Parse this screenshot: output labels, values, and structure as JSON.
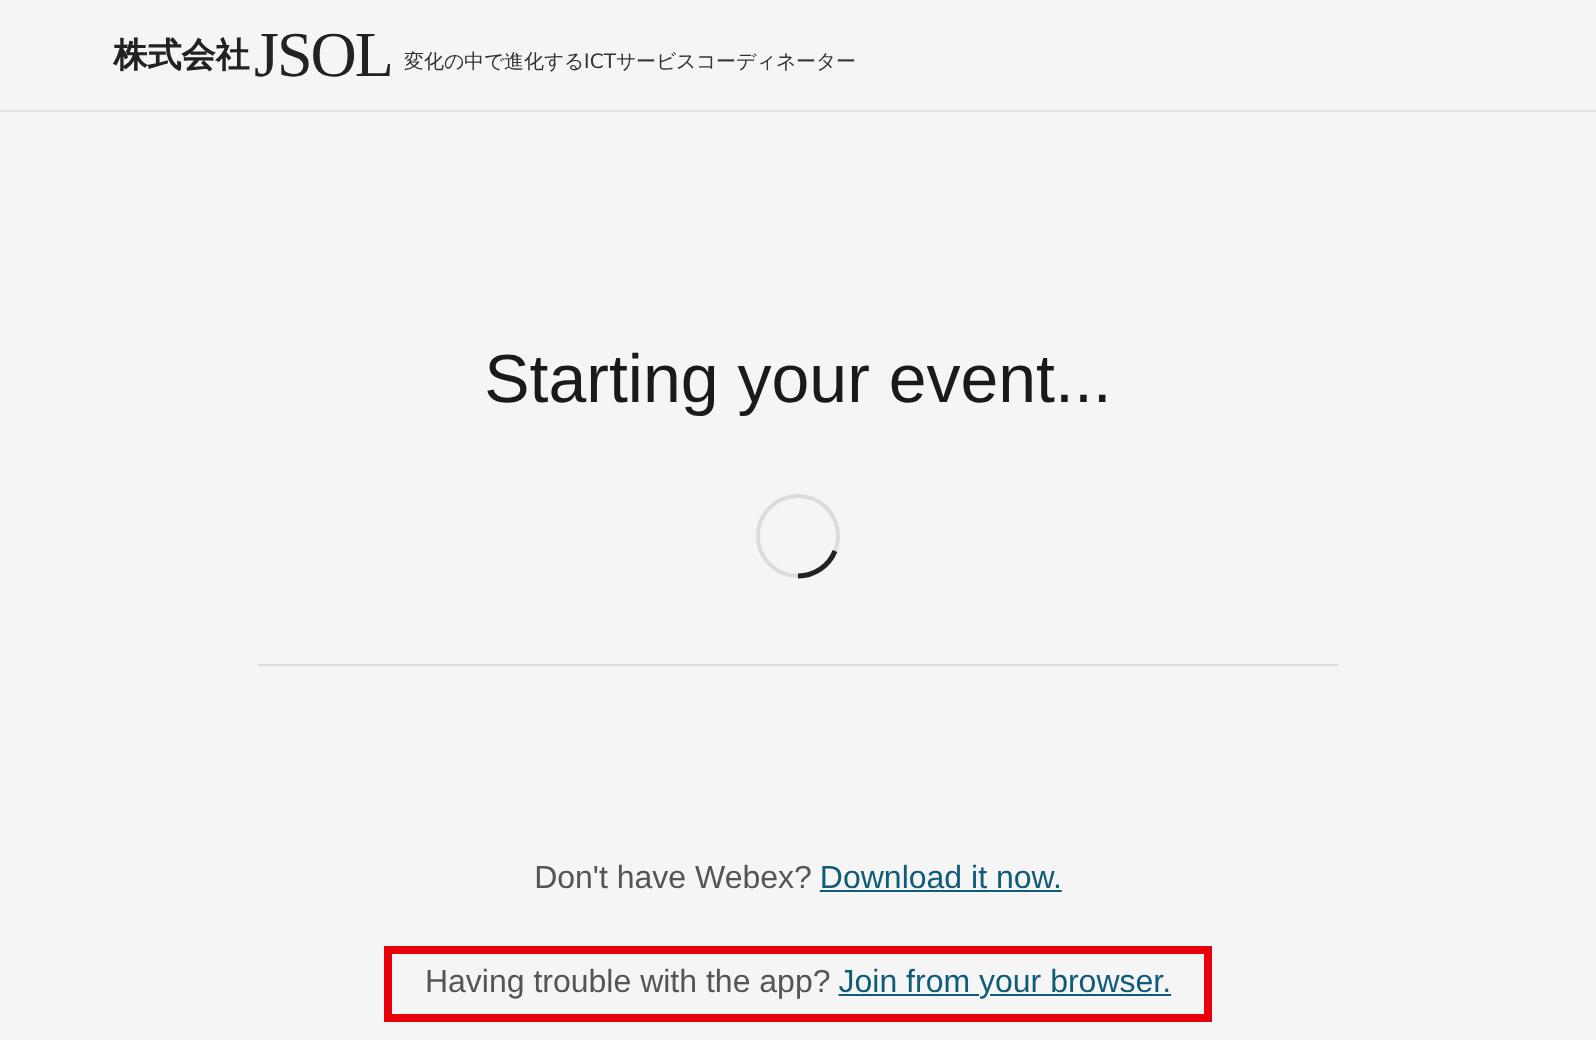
{
  "header": {
    "company": "株式会社",
    "logo": "JSOL",
    "tagline": "変化の中で進化するICTサービスコーディネーター"
  },
  "title": "Starting your event...",
  "lines": [
    {
      "text": "Don't have Webex?",
      "link": "Download it now.",
      "highlighted": false
    },
    {
      "text": "Having trouble with the app?",
      "link": "Join from your browser.",
      "highlighted": true
    }
  ]
}
